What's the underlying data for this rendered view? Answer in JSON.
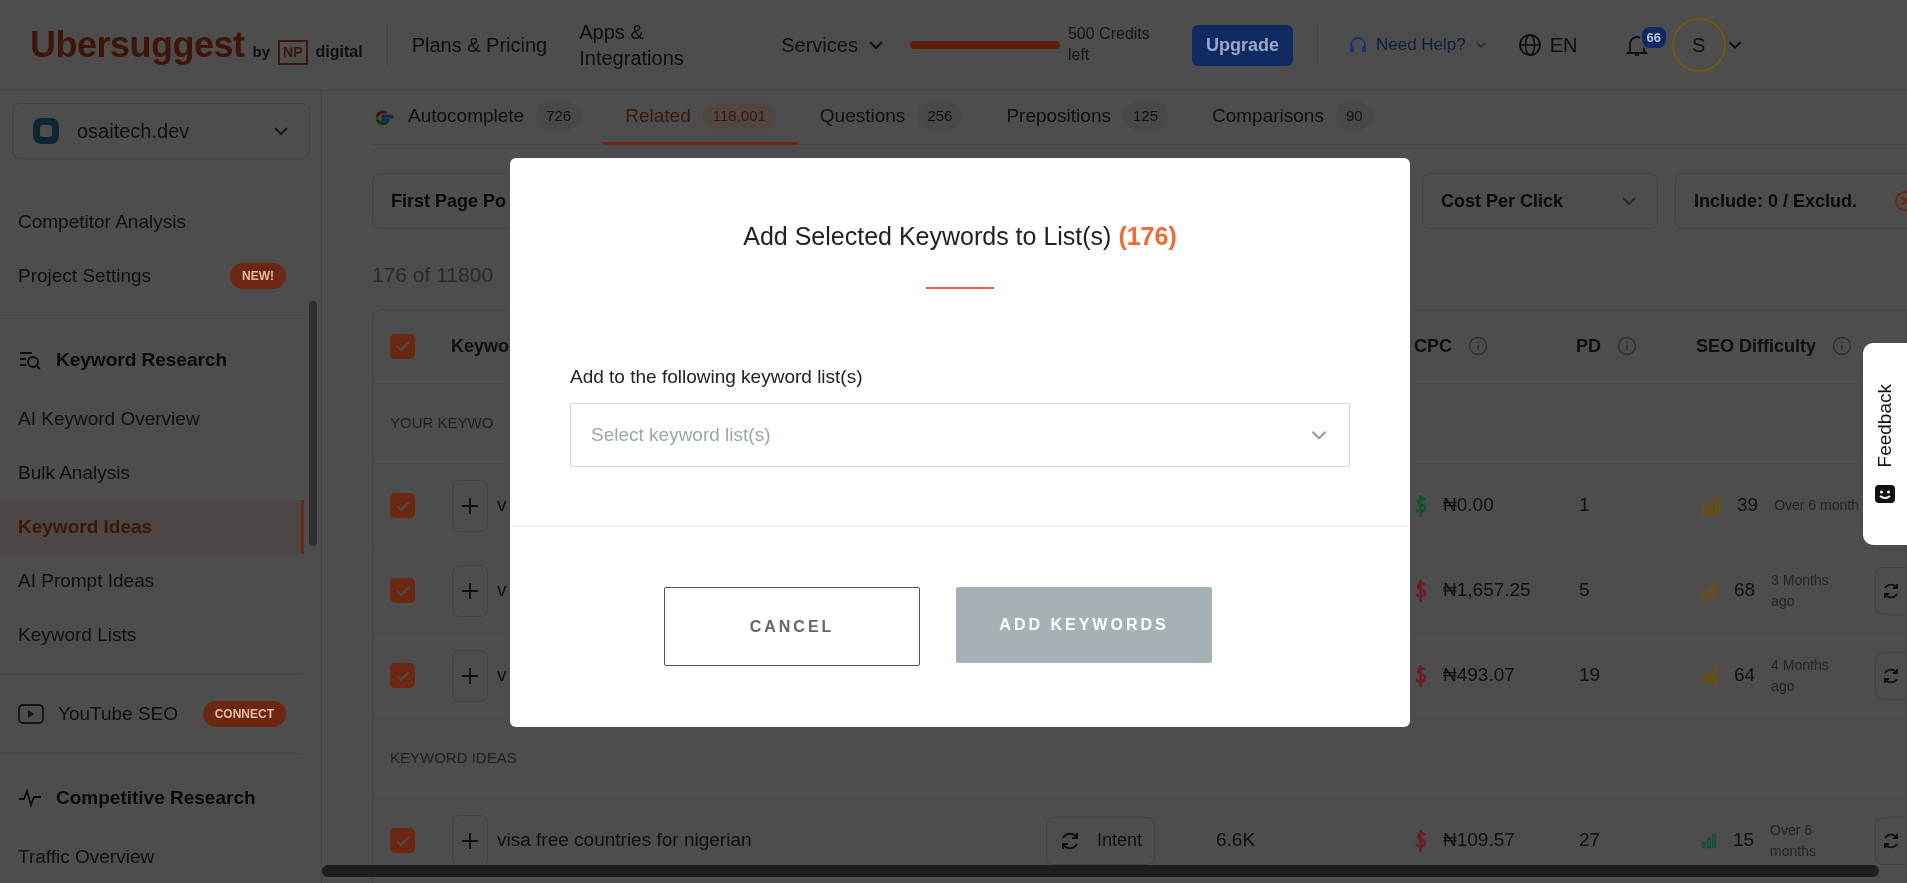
{
  "header": {
    "logo": "Ubersuggest",
    "logo_by": "by",
    "logo_np": "NP",
    "logo_digital": "digital",
    "nav": [
      {
        "label": "Plans & Pricing",
        "kind": "link"
      },
      {
        "label": "Apps & Integrations",
        "kind": "link"
      },
      {
        "label": "Services",
        "kind": "dropdown"
      }
    ],
    "credits": {
      "level": 1,
      "label": "500 Credits left"
    },
    "upgrade": "Upgrade",
    "help": "Need Help?",
    "language": "EN",
    "notifications": "66",
    "avatar": "S"
  },
  "sidebar": {
    "project": "osaitech.dev",
    "items": [
      {
        "kind": "link",
        "label": "Competitor Analysis",
        "selected": false
      },
      {
        "kind": "link",
        "label": "Project Settings",
        "badge": "NEW!",
        "selected": false
      },
      {
        "kind": "divider"
      },
      {
        "kind": "heading",
        "label": "Keyword Research"
      },
      {
        "kind": "link",
        "label": "AI Keyword Overview",
        "selected": false
      },
      {
        "kind": "link",
        "label": "Bulk Analysis",
        "selected": false
      },
      {
        "kind": "link",
        "label": "Keyword Ideas",
        "selected": true
      },
      {
        "kind": "link",
        "label": "AI Prompt Ideas",
        "selected": false
      },
      {
        "kind": "link",
        "label": "Keyword Lists",
        "selected": false
      },
      {
        "kind": "divider"
      },
      {
        "kind": "channel",
        "label": "YouTube SEO",
        "badge": "CONNECT",
        "selected": false
      },
      {
        "kind": "divider"
      },
      {
        "kind": "heading",
        "label": "Competitive Research"
      },
      {
        "kind": "link",
        "label": "Traffic Overview",
        "selected": false
      }
    ]
  },
  "tabs": [
    {
      "label": "Autocomplete",
      "count": "726",
      "selected": false
    },
    {
      "label": "Related",
      "count": "118,001",
      "selected": true
    },
    {
      "label": "Questions",
      "count": "256",
      "selected": false
    },
    {
      "label": "Prepositions",
      "count": "125",
      "selected": false
    },
    {
      "label": "Comparisons",
      "count": "90",
      "selected": false
    }
  ],
  "filters": [
    {
      "label": "First Page Po",
      "kind": "select"
    },
    {
      "label": "Cost Per Click",
      "kind": "select"
    },
    {
      "label": "Include: 0 / Exclud.",
      "kind": "include"
    }
  ],
  "result_count": "176 of 11800",
  "table": {
    "select_all": true,
    "columns": [
      {
        "label": "Keywo",
        "info": false
      },
      {
        "label": "CPC",
        "info": true
      },
      {
        "label": "PD",
        "info": true
      },
      {
        "label": "SEO Difficulty",
        "info": true
      }
    ],
    "groups": [
      {
        "title": "YOUR KEYWO",
        "rows": [
          {
            "checked": true,
            "keyword": "v",
            "cpc": {
              "value": "₦0.00",
              "color": "#13502e"
            },
            "pd": "1",
            "seo": {
              "value": "39",
              "color": "#6e4f0c"
            },
            "updated": "Over 6 month",
            "refresh": false
          },
          {
            "checked": true,
            "keyword": "v",
            "cpc": {
              "value": "₦1,657.25",
              "color": "#6a1c26"
            },
            "pd": "5",
            "seo": {
              "value": "68",
              "color": "#6e4f0c"
            },
            "updated": "3 Months ago",
            "refresh": true
          },
          {
            "checked": true,
            "keyword": "v",
            "cpc": {
              "value": "₦493.07",
              "color": "#6a1c26"
            },
            "pd": "19",
            "seo": {
              "value": "64",
              "color": "#6e4f0c"
            },
            "updated": "4 Months ago",
            "refresh": true
          }
        ]
      },
      {
        "title": "KEYWORD IDEAS",
        "rows": [
          {
            "checked": true,
            "keyword": "visa free countries for nigerian",
            "intent": "Intent",
            "volume": "6.6K",
            "cpc": {
              "value": "₦109.57",
              "color": "#6a1c26"
            },
            "pd": "27",
            "seo": {
              "value": "15",
              "color": "#13502e"
            },
            "updated": "Over 6 months",
            "refresh": true
          }
        ]
      }
    ]
  },
  "feedback": "Feedback",
  "modal": {
    "title": "Add Selected Keywords to List(s)",
    "count": "(176)",
    "label": "Add to the following keyword list(s)",
    "placeholder": "Select keyword list(s)",
    "cancel": "CANCEL",
    "confirm": "ADD KEYWORDS",
    "confirm_disabled": true
  }
}
